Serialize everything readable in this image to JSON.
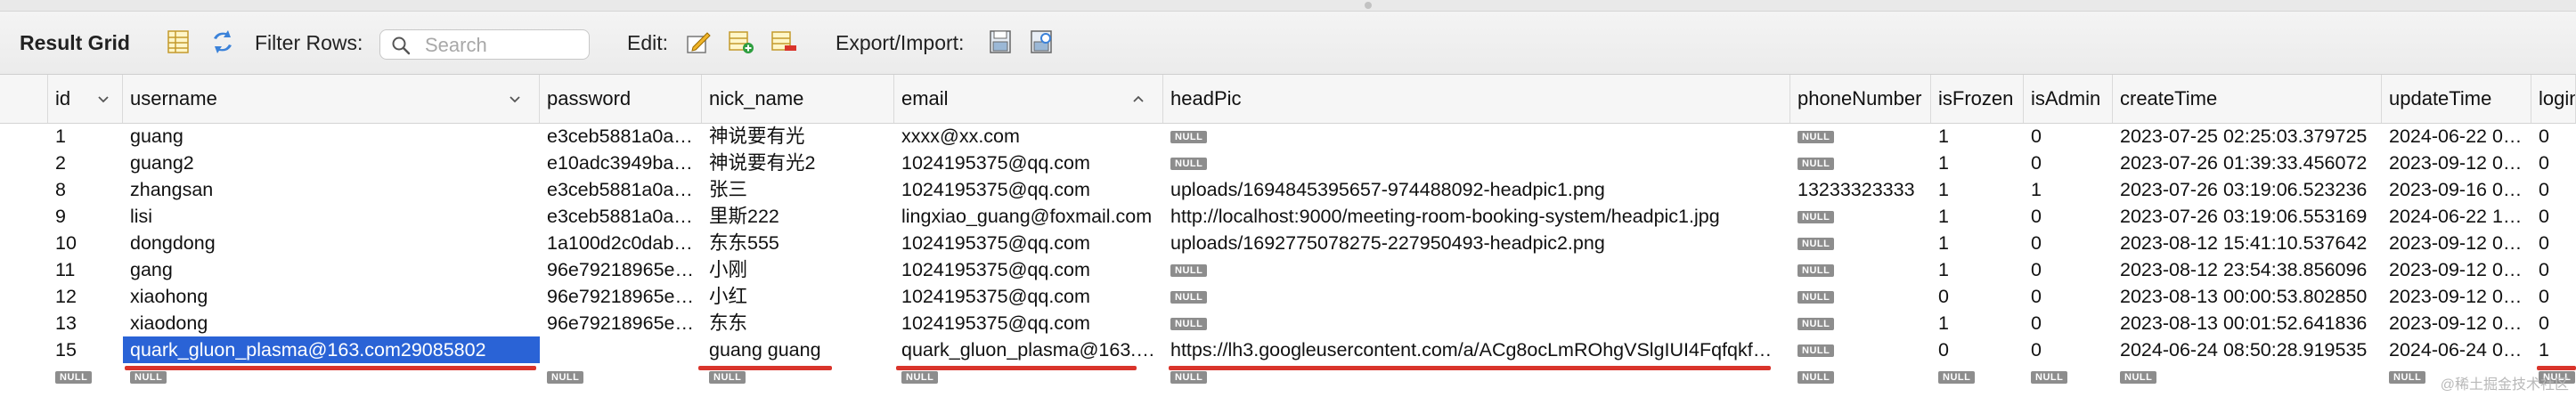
{
  "toolbar": {
    "title": "Result Grid",
    "filter_label": "Filter Rows:",
    "search_placeholder": "Search",
    "edit_label": "Edit:",
    "export_label": "Export/Import:"
  },
  "columns": [
    "id",
    "username",
    "password",
    "nick_name",
    "email",
    "headPic",
    "phoneNumber",
    "isFrozen",
    "isAdmin",
    "createTime",
    "updateTime",
    "login"
  ],
  "null_label": "NULL",
  "rows": [
    {
      "id": "1",
      "username": "guang",
      "password": "e3ceb5881a0a…",
      "nick_name": "神说要有光",
      "email": "xxxx@xx.com",
      "headPic": null,
      "phoneNumber": null,
      "isFrozen": "1",
      "isAdmin": "0",
      "createTime": "2023-07-25 02:25:03.379725",
      "updateTime": "2024-06-22 0…",
      "login": "0"
    },
    {
      "id": "2",
      "username": "guang2",
      "password": "e10adc3949ba…",
      "nick_name": "神说要有光2",
      "email": "1024195375@qq.com",
      "headPic": null,
      "phoneNumber": null,
      "isFrozen": "1",
      "isAdmin": "0",
      "createTime": "2023-07-26 01:39:33.456072",
      "updateTime": "2023-09-12 0…",
      "login": "0"
    },
    {
      "id": "8",
      "username": "zhangsan",
      "password": "e3ceb5881a0a…",
      "nick_name": "张三",
      "email": "1024195375@qq.com",
      "headPic": "uploads/1694845395657-974488092-headpic1.png",
      "phoneNumber": "13233323333",
      "isFrozen": "1",
      "isAdmin": "1",
      "createTime": "2023-07-26 03:19:06.523236",
      "updateTime": "2023-09-16 0…",
      "login": "0"
    },
    {
      "id": "9",
      "username": "lisi",
      "password": "e3ceb5881a0a…",
      "nick_name": "里斯222",
      "email": "lingxiao_guang@foxmail.com",
      "headPic": "http://localhost:9000/meeting-room-booking-system/headpic1.jpg",
      "phoneNumber": null,
      "isFrozen": "1",
      "isAdmin": "0",
      "createTime": "2023-07-26 03:19:06.553169",
      "updateTime": "2024-06-22 1…",
      "login": "0"
    },
    {
      "id": "10",
      "username": "dongdong",
      "password": "1a100d2c0dab…",
      "nick_name": "东东555",
      "email": "1024195375@qq.com",
      "headPic": "uploads/1692775078275-227950493-headpic2.png",
      "phoneNumber": null,
      "isFrozen": "1",
      "isAdmin": "0",
      "createTime": "2023-08-12 15:41:10.537642",
      "updateTime": "2023-09-12 0…",
      "login": "0"
    },
    {
      "id": "11",
      "username": "gang",
      "password": "96e79218965e…",
      "nick_name": "小刚",
      "email": "1024195375@qq.com",
      "headPic": null,
      "phoneNumber": null,
      "isFrozen": "1",
      "isAdmin": "0",
      "createTime": "2023-08-12 23:54:38.856096",
      "updateTime": "2023-09-12 0…",
      "login": "0"
    },
    {
      "id": "12",
      "username": "xiaohong",
      "password": "96e79218965e…",
      "nick_name": "小红",
      "email": "1024195375@qq.com",
      "headPic": null,
      "phoneNumber": null,
      "isFrozen": "0",
      "isAdmin": "0",
      "createTime": "2023-08-13 00:00:53.802850",
      "updateTime": "2023-09-12 0…",
      "login": "0"
    },
    {
      "id": "13",
      "username": "xiaodong",
      "password": "96e79218965e…",
      "nick_name": "东东",
      "email": "1024195375@qq.com",
      "headPic": null,
      "phoneNumber": null,
      "isFrozen": "1",
      "isAdmin": "0",
      "createTime": "2023-08-13 00:01:52.641836",
      "updateTime": "2023-09-12 0…",
      "login": "0"
    },
    {
      "id": "15",
      "username": "quark_gluon_plasma@163.com29085802",
      "password": "",
      "nick_name": "guang guang",
      "email": "quark_gluon_plasma@163.…",
      "headPic": "https://lh3.googleusercontent.com/a/ACg8ocLmROhgVSlgIUI4Fqfqkf…",
      "phoneNumber": null,
      "isFrozen": "0",
      "isAdmin": "0",
      "createTime": "2024-06-24 08:50:28.919535",
      "updateTime": "2024-06-24 0…",
      "login": "1"
    },
    {
      "id": null,
      "username": null,
      "password": null,
      "nick_name": null,
      "email": null,
      "headPic": null,
      "phoneNumber": null,
      "isFrozen": null,
      "isAdmin": null,
      "createTime": null,
      "updateTime": null,
      "login": null
    }
  ],
  "selected_row": 8,
  "watermark": "@稀土掘金技术社区"
}
